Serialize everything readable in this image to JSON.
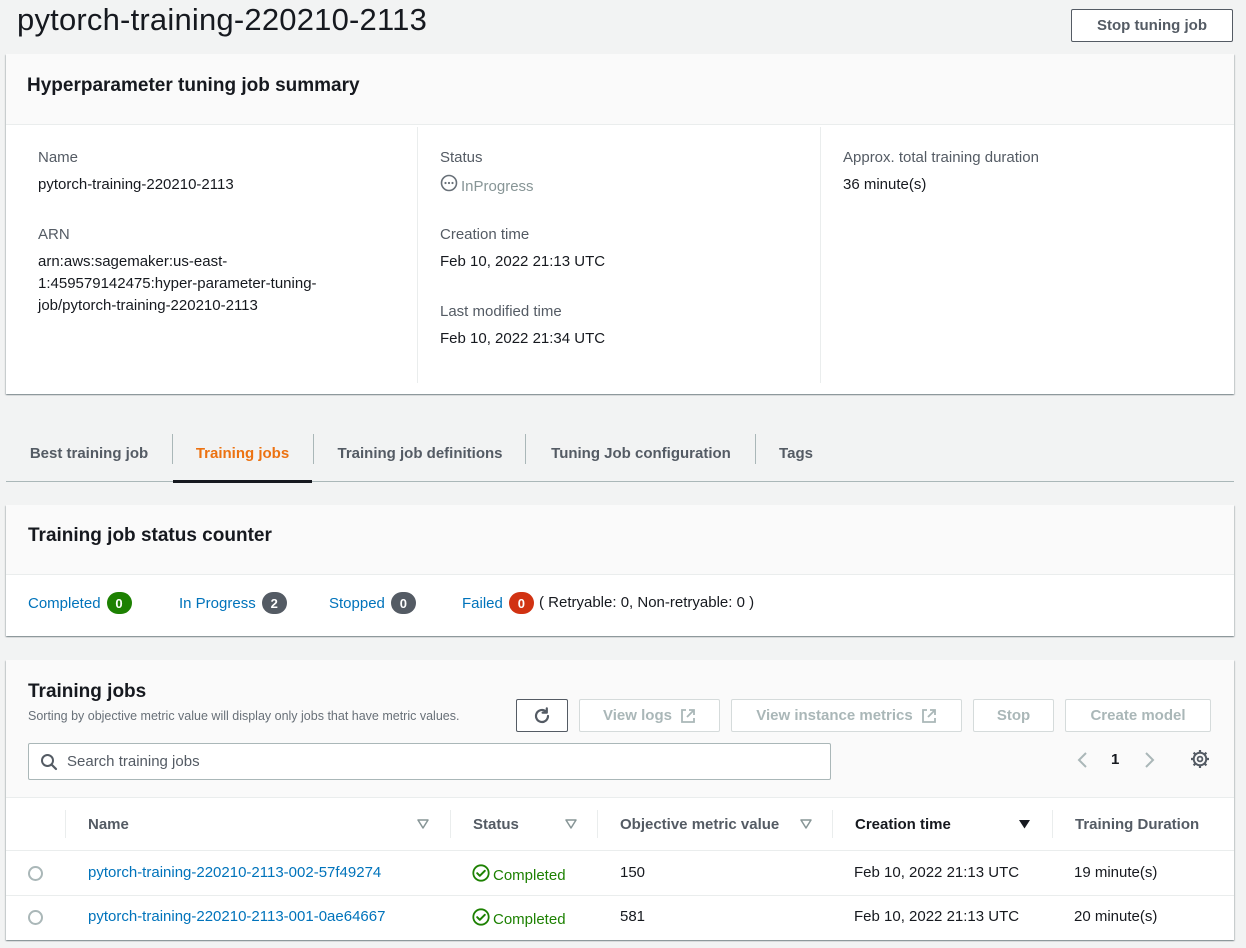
{
  "page": {
    "title": "pytorch-training-220210-2113",
    "stop_button": "Stop tuning job"
  },
  "summary": {
    "title": "Hyperparameter tuning job summary",
    "name_label": "Name",
    "name_value": "pytorch-training-220210-2113",
    "arn_label": "ARN",
    "arn_lines": [
      "arn:aws:sagemaker:us-east-",
      "1:459579142475:hyper-parameter-tuning-",
      "job/pytorch-training-220210-2113"
    ],
    "status_label": "Status",
    "status_value": "InProgress",
    "creation_label": "Creation time",
    "creation_value": "Feb 10, 2022 21:13 UTC",
    "modified_label": "Last modified time",
    "modified_value": "Feb 10, 2022 21:34 UTC",
    "duration_label": "Approx. total training duration",
    "duration_value": "36 minute(s)"
  },
  "tabs": [
    "Best training job",
    "Training jobs",
    "Training job definitions",
    "Tuning Job configuration",
    "Tags"
  ],
  "active_tab": "Training jobs",
  "counter": {
    "title": "Training job status counter",
    "completed_label": "Completed",
    "completed_count": "0",
    "inprogress_label": "In Progress",
    "inprogress_count": "2",
    "stopped_label": "Stopped",
    "stopped_count": "0",
    "failed_label": "Failed",
    "failed_count": "0",
    "failed_detail": "( Retryable: 0, Non-retryable: 0 )"
  },
  "jobs": {
    "title": "Training jobs",
    "subtitle": "Sorting by objective metric value will display only jobs that have metric values.",
    "view_logs": "View logs",
    "view_metrics": "View instance metrics",
    "stop": "Stop",
    "create_model": "Create model",
    "search_placeholder": "Search training jobs",
    "page": "1",
    "columns": [
      "Name",
      "Status",
      "Objective metric value",
      "Creation time",
      "Training Duration"
    ],
    "rows": [
      {
        "name": "pytorch-training-220210-2113-002-57f49274",
        "status": "Completed",
        "metric": "150",
        "created": "Feb 10, 2022 21:13 UTC",
        "duration": "19 minute(s)"
      },
      {
        "name": "pytorch-training-220210-2113-001-0ae64667",
        "status": "Completed",
        "metric": "581",
        "created": "Feb 10, 2022 21:13 UTC",
        "duration": "20 minute(s)"
      }
    ]
  },
  "colors": {
    "accent": "#ec7211",
    "link": "#0073bb",
    "success": "#1d8102",
    "error": "#d13212"
  }
}
